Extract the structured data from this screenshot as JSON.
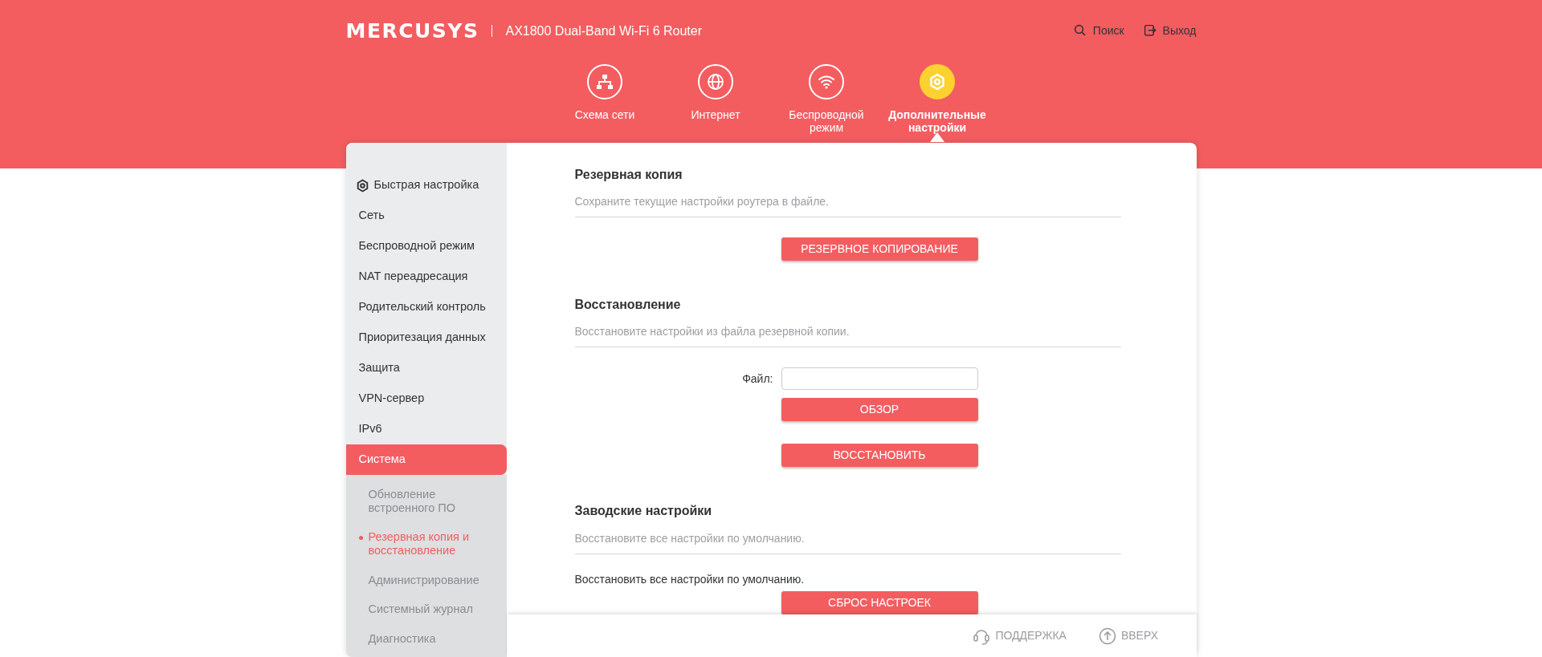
{
  "header": {
    "logo": "MERCUSYS",
    "model": "AX1800 Dual-Band Wi-Fi 6 Router",
    "actions": [
      {
        "kind": "search",
        "label": "Поиск"
      },
      {
        "kind": "logout",
        "label": "Выход"
      }
    ]
  },
  "tabs": [
    {
      "kind": "network",
      "label": "Схема сети",
      "selected": false
    },
    {
      "kind": "internet",
      "label": "Интернет",
      "selected": false
    },
    {
      "kind": "wireless",
      "label": "Беспроводной режим",
      "selected": false
    },
    {
      "kind": "advanced",
      "label": "Дополнительные настройки",
      "selected": true
    }
  ],
  "sidebar": {
    "items": [
      {
        "kind": "quick",
        "label": "Быстрая настройка",
        "selected": false
      },
      {
        "label": "Сеть",
        "selected": false
      },
      {
        "label": "Беспроводной режим",
        "selected": false
      },
      {
        "label": "NAT переадресация",
        "selected": false
      },
      {
        "label": "Родительский контроль",
        "selected": false
      },
      {
        "label": "Приоритезация данных",
        "selected": false
      },
      {
        "label": "Защита",
        "selected": false
      },
      {
        "label": "VPN-сервер",
        "selected": false
      },
      {
        "label": "IPv6",
        "selected": false
      },
      {
        "label": "Система",
        "selected": true,
        "children": [
          {
            "label": "Обновление встроенного ПО",
            "selected": false
          },
          {
            "label": "Резервная копия и восстановление",
            "selected": true
          },
          {
            "label": "Администрирование",
            "selected": false
          },
          {
            "label": "Системный журнал",
            "selected": false
          },
          {
            "label": "Диагностика",
            "selected": false
          }
        ]
      }
    ]
  },
  "sections": [
    {
      "title": "Резервная копия",
      "description": "Сохраните текущие настройки роутера в файле.",
      "rows": [
        {
          "kind": "button",
          "label": "РЕЗЕРВНОЕ КОПИРОВАНИЕ"
        }
      ]
    },
    {
      "title": "Восстановление",
      "description": "Восстановите настройки из файла резервной копии.",
      "rows": [
        {
          "kind": "file",
          "label": "Файл:"
        },
        {
          "kind": "button",
          "label": "ОБЗОР"
        },
        {
          "kind": "spacer"
        },
        {
          "kind": "button",
          "label": "ВОССТАНОВИТЬ"
        }
      ]
    },
    {
      "title": "Заводские настройки",
      "description": "Восстановите все настройки по умолчанию.",
      "rows": [
        {
          "kind": "text",
          "label": "Восстановить все настройки по умолчанию."
        },
        {
          "kind": "button",
          "label": "СБРОС НАСТРОЕК"
        }
      ]
    }
  ],
  "footer": [
    {
      "kind": "support",
      "label": "ПОДДЕРЖКА"
    },
    {
      "kind": "top",
      "label": "ВВЕРХ"
    }
  ]
}
